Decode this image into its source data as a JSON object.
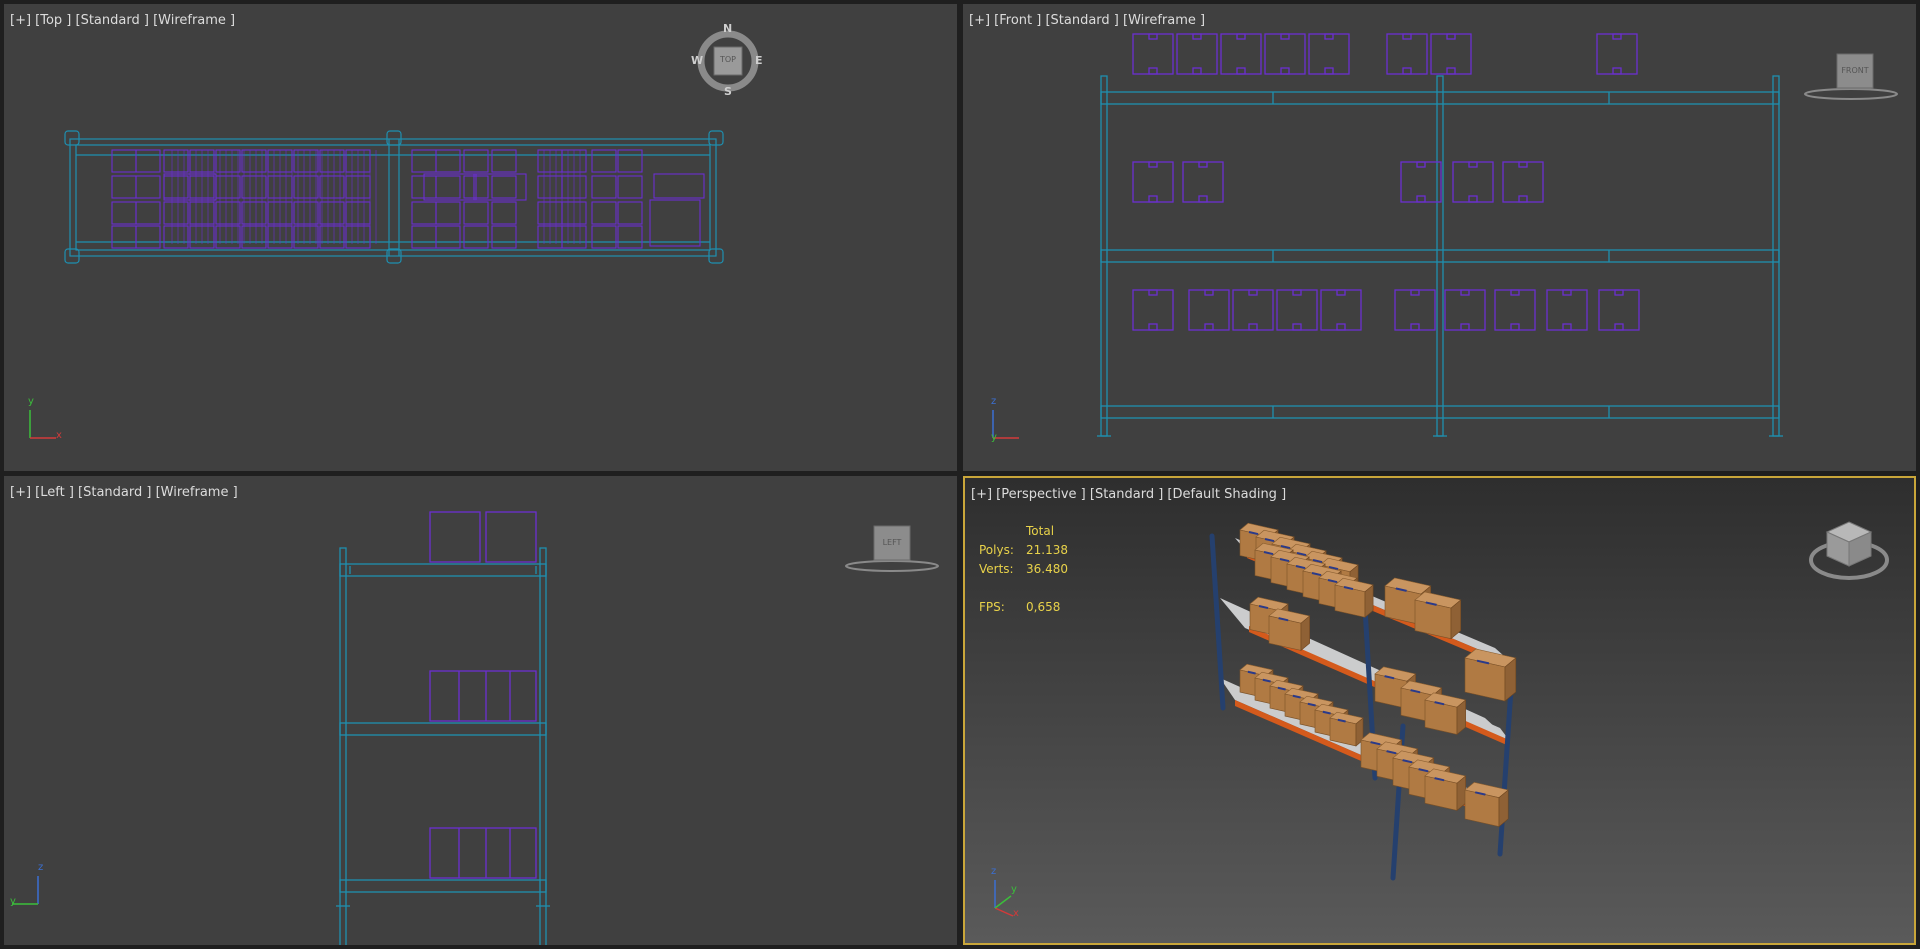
{
  "colors": {
    "viewport_bg": "#404040",
    "frame_bg": "#1f1f1f",
    "wire_rack": "#1e8fb0",
    "wire_box": "#6b2fd0",
    "active_border": "#c9a63a",
    "stats_text": "#e8d24a",
    "box_brown": "#b5834e",
    "shelf_white": "#cfd0d2",
    "rack_orange": "#d45a1c",
    "upright_blue": "#25406e"
  },
  "viewports": {
    "top": {
      "label": "[+] [Top ] [Standard ] [Wireframe ]"
    },
    "front": {
      "label": "[+] [Front ] [Standard ] [Wireframe ]"
    },
    "left": {
      "label": "[+] [Left ] [Standard ] [Wireframe ]"
    },
    "perspective": {
      "label": "[+] [Perspective ] [Standard ] [Default Shading ]"
    }
  },
  "stats": {
    "header": "Total",
    "polys_label": "Polys:",
    "polys_value": "21.138",
    "verts_label": "Verts:",
    "verts_value": "36.480",
    "fps_label": "FPS:",
    "fps_value": "0,658"
  },
  "gizmos": {
    "top_cube": "TOP",
    "front_cube": "FRONT",
    "left_cube": "LEFT",
    "compass_n": "N",
    "compass_s": "S",
    "compass_e": "E",
    "compass_w": "W",
    "axis_top_v": "y",
    "axis_top_h": "x",
    "axis_front_v": "z",
    "axis_front_h": "y",
    "axis_left_v": "z",
    "axis_left_h": "y",
    "axis_persp_z": "z",
    "axis_persp_y": "y",
    "axis_persp_x": "x"
  },
  "icons": [
    "viewcube-icon",
    "compass-icon",
    "axis-tripod-icon"
  ]
}
